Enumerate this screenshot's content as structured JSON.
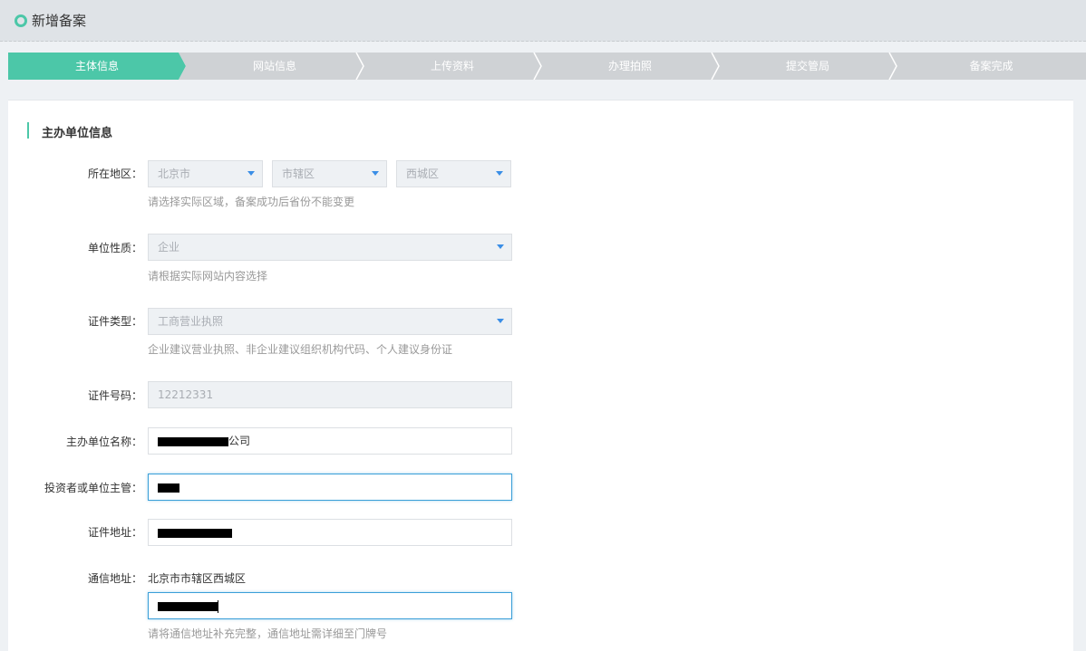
{
  "header": {
    "title": "新增备案"
  },
  "steps": [
    {
      "label": "主体信息",
      "active": true
    },
    {
      "label": "网站信息",
      "active": false
    },
    {
      "label": "上传资料",
      "active": false
    },
    {
      "label": "办理拍照",
      "active": false
    },
    {
      "label": "提交管局",
      "active": false
    },
    {
      "label": "备案完成",
      "active": false
    }
  ],
  "colors": {
    "accent": "#4cc7a8",
    "step_inactive": "#cfd2d5",
    "focus": "#3a9fd8"
  },
  "section": {
    "title": "主办单位信息"
  },
  "form": {
    "region": {
      "label": "所在地区：",
      "province": "北京市",
      "city": "市辖区",
      "district": "西城区",
      "hint": "请选择实际区域，备案成功后省份不能变更"
    },
    "unit_nature": {
      "label": "单位性质：",
      "value": "企业",
      "hint": "请根据实际网站内容选择"
    },
    "cert_type": {
      "label": "证件类型：",
      "value": "工商营业执照",
      "hint": "企业建议营业执照、非企业建议组织机构代码、个人建议身份证"
    },
    "cert_number": {
      "label": "证件号码：",
      "value": "12212331"
    },
    "org_name": {
      "label": "主办单位名称：",
      "value_suffix": "公司"
    },
    "investor": {
      "label": "投资者或单位主管："
    },
    "cert_address": {
      "label": "证件地址："
    },
    "comm_address": {
      "label": "通信地址：",
      "prefix": "北京市市辖区西城区",
      "hint": "请将通信地址补充完整，通信地址需详细至门牌号"
    }
  }
}
